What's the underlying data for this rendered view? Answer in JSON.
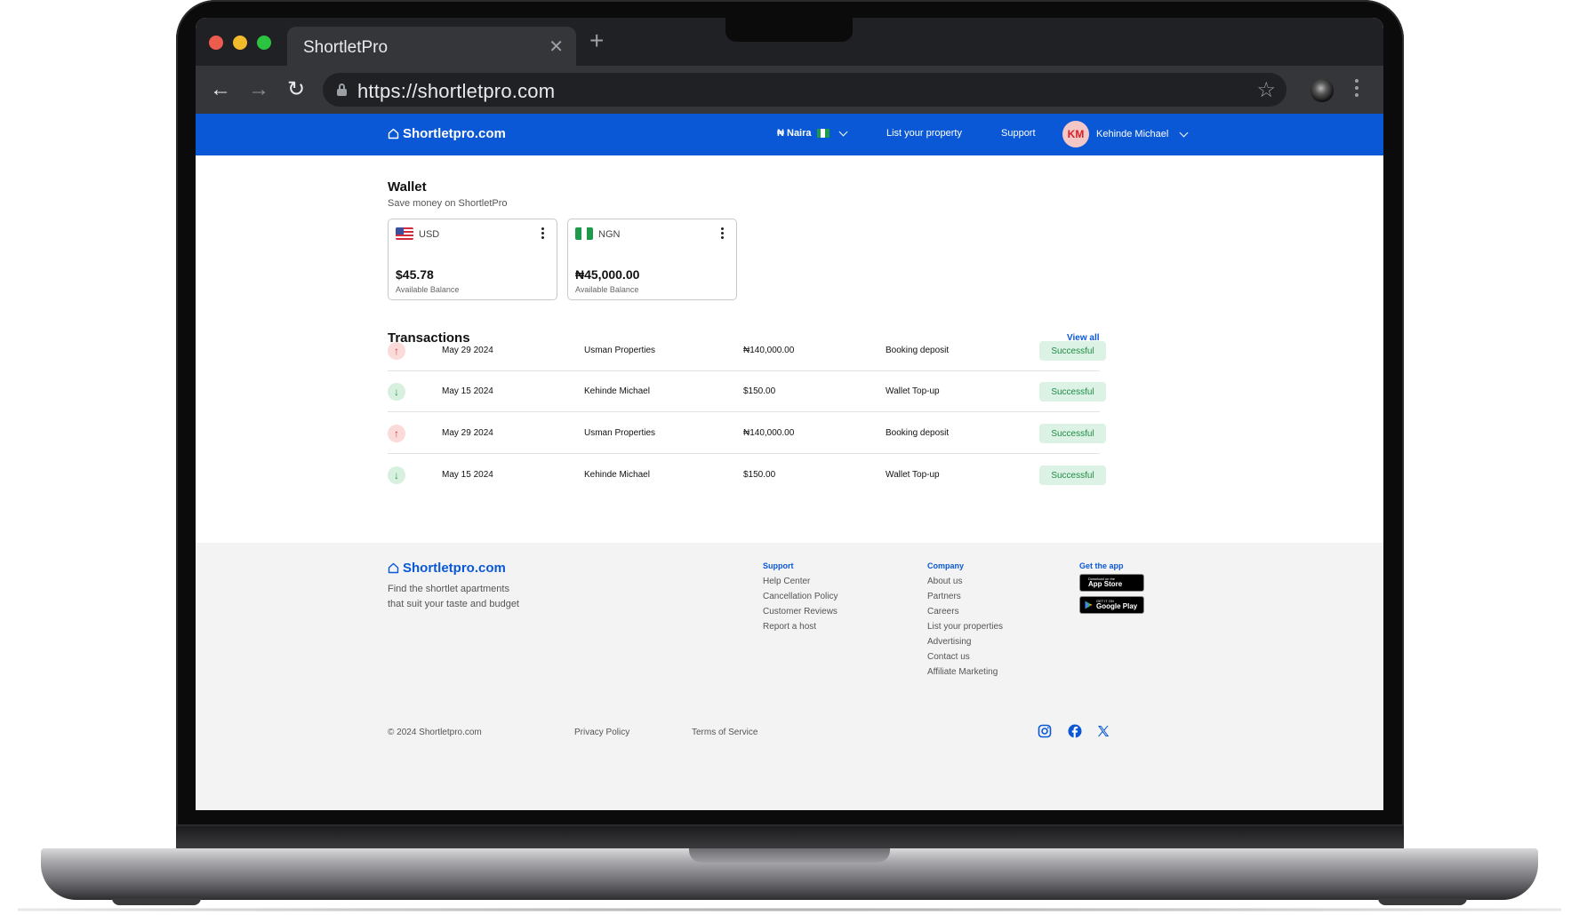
{
  "browser": {
    "tab_title": "ShortletPro",
    "url": "https://shortletpro.com"
  },
  "header": {
    "logo": "Shortletpro.com",
    "currency": "₦ Naira",
    "list_property": "List your property",
    "support": "Support",
    "avatar_initials": "KM",
    "user_name": "Kehinde Michael"
  },
  "wallet": {
    "title": "Wallet",
    "subtitle": "Save money on ShortletPro",
    "cards": [
      {
        "currency": "USD",
        "amount": "$45.78",
        "label": "Available Balance"
      },
      {
        "currency": "NGN",
        "amount": "₦45,000.00",
        "label": "Available Balance"
      }
    ]
  },
  "transactions": {
    "title": "Transactions",
    "view_all": "View all",
    "rows": [
      {
        "direction": "out",
        "date": "May 29 2024",
        "party": "Usman Properties",
        "amount": "₦140,000.00",
        "description": "Booking deposit",
        "status": "Successful"
      },
      {
        "direction": "in",
        "date": "May 15 2024",
        "party": "Kehinde Michael",
        "amount": "$150.00",
        "description": "Wallet Top-up",
        "status": "Successful"
      },
      {
        "direction": "out",
        "date": "May 29 2024",
        "party": "Usman Properties",
        "amount": "₦140,000.00",
        "description": "Booking deposit",
        "status": "Successful"
      },
      {
        "direction": "in",
        "date": "May 15 2024",
        "party": "Kehinde Michael",
        "amount": "$150.00",
        "description": "Wallet Top-up",
        "status": "Successful"
      }
    ]
  },
  "footer": {
    "logo": "Shortletpro.com",
    "tagline_line1": "Find the shortlet apartments",
    "tagline_line2": "that suit your taste and budget",
    "support_heading": "Support",
    "support_links": [
      "Help Center",
      "Cancellation Policy",
      "Customer Reviews",
      "Report a host"
    ],
    "company_heading": "Company",
    "company_links": [
      "About us",
      "Partners",
      "Careers",
      "List your properties",
      "Advertising",
      "Contact us",
      "Affiliate Marketing"
    ],
    "app_heading": "Get the app",
    "app_store_small": "Download on the",
    "app_store_big": "App Store",
    "google_play_small": "GET IT ON",
    "google_play_big": "Google Play",
    "copyright": "© 2024 Shortletpro.com",
    "privacy": "Privacy Policy",
    "terms": "Terms of Service"
  },
  "colors": {
    "brand_blue": "#0a58d6",
    "success_bg": "#dcf2e4",
    "success_text": "#1f8b45"
  }
}
